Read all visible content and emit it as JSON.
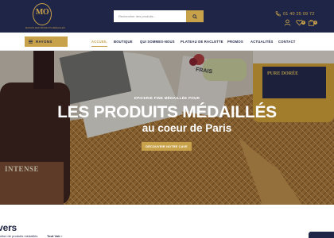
{
  "header": {
    "logo_monogram": "MO",
    "logo_tagline": "MAISON DES PRODUITS MÉDAILLÉS",
    "search_placeholder": "Rechercher des produits...",
    "phone": "01 40 25 09 72",
    "cart_count": "0",
    "wishlist_count": "0",
    "colors": {
      "navy": "#1f2547",
      "gold": "#c8a24a"
    }
  },
  "nav": {
    "category_button": "RAYONS",
    "items": [
      "ACCUEIL",
      "BOUTIQUE",
      "QUI SOMMES-NOUS",
      "PLATEAU DE RACLETTE",
      "PROMOS",
      "ACTUALITÉS",
      "CONTACT"
    ],
    "active_item": "ACCUEIL"
  },
  "hero": {
    "kicker": "EPICERIE FINE MÉDAILLÉE POUR",
    "title": "LES PRODUITS MÉDAILLÉS",
    "subtitle": "au coeur de Paris",
    "cta": "DÉCOUVRIR NOTRE CAVE",
    "bottle_label": "INTENSE",
    "package_label": "FRAIS",
    "jar_label": "PURE DORÉE"
  },
  "section": {
    "title": "ivers",
    "subtitle": "ction de produits médaillés",
    "link": "Tout Voir ›"
  }
}
